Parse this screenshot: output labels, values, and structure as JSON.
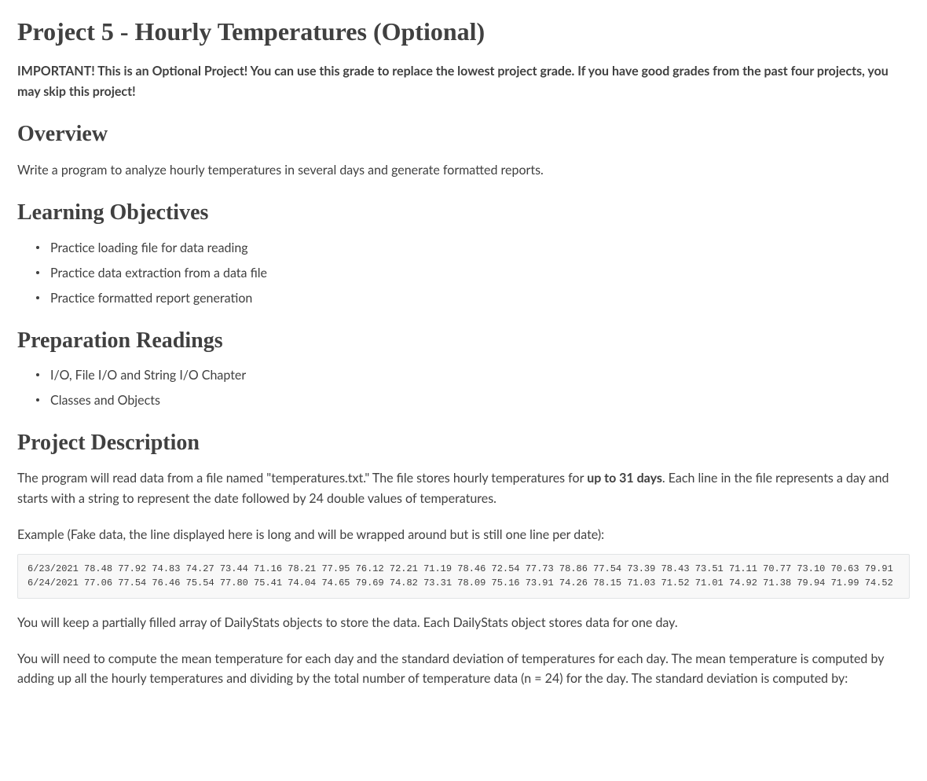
{
  "title": "Project 5 - Hourly Temperatures (Optional)",
  "important_notice": "IMPORTANT! This is an Optional Project! You can use this grade to replace the lowest project grade. If you have good grades from the past four projects, you may skip this project!",
  "overview": {
    "heading": "Overview",
    "text": "Write a program to analyze hourly temperatures in several days and generate formatted reports."
  },
  "learning_objectives": {
    "heading": "Learning Objectives",
    "items": [
      "Practice loading file for data reading",
      "Practice data extraction from a data file",
      "Practice formatted report generation"
    ]
  },
  "preparation_readings": {
    "heading": "Preparation Readings",
    "items": [
      "I/O, File I/O and String I/O Chapter",
      "Classes and Objects"
    ]
  },
  "project_description": {
    "heading": "Project Description",
    "p1_part1": "The program will read data from a file named \"temperatures.txt.\" The file stores hourly temperatures for ",
    "p1_bold": "up to 31 days",
    "p1_part2": ". Each line in the file represents a day and starts with a string to represent the date followed by 24 double values of temperatures.",
    "example_intro": "Example (Fake data, the line displayed here is long and will be wrapped around but is still one line per date):",
    "code_block": "6/23/2021 78.48 77.92 74.83 74.27 73.44 71.16 78.21 77.95 76.12 72.21 71.19 78.46 72.54 77.73 78.86 77.54 73.39 78.43 73.51 71.11 70.77 73.10 70.63 79.91\n6/24/2021 77.06 77.54 76.46 75.54 77.80 75.41 74.04 74.65 79.69 74.82 73.31 78.09 75.16 73.91 74.26 78.15 71.03 71.52 71.01 74.92 71.38 79.94 71.99 74.52",
    "p2": "You will keep a partially filled array of DailyStats objects to store the data. Each DailyStats object stores data for one day.",
    "p3": "You will need to compute the mean temperature for each day and the standard deviation of temperatures for each day. The mean temperature is computed by adding up all the hourly temperatures and dividing by the total number of temperature data (n = 24) for the day. The standard deviation is computed by:"
  }
}
